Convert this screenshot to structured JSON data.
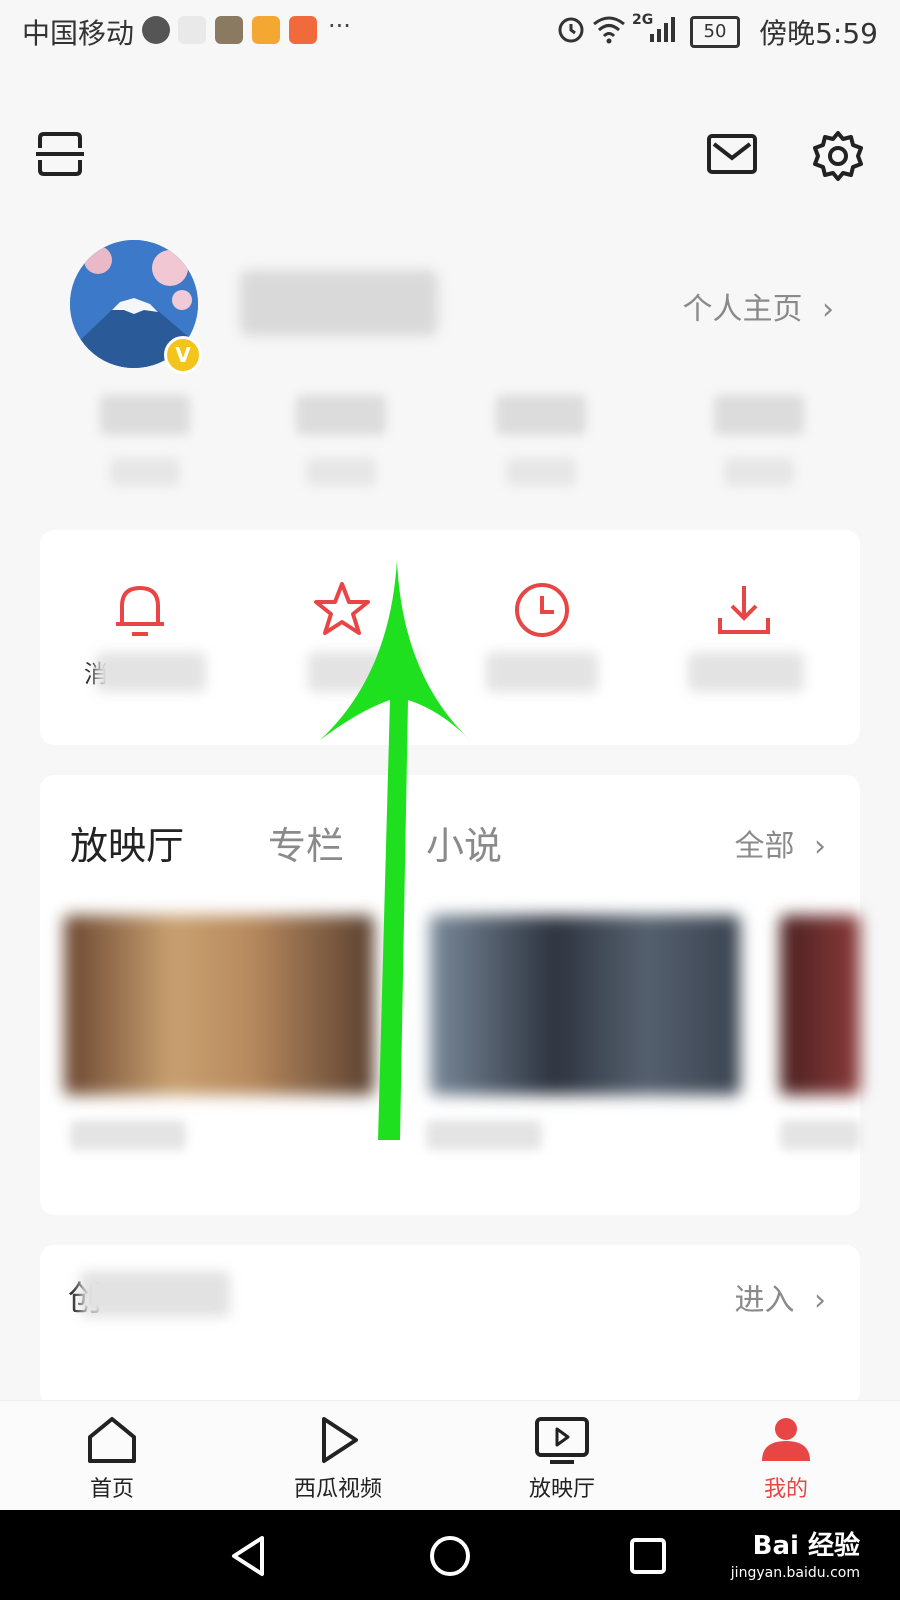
{
  "status_bar": {
    "carrier": "中国移动",
    "more": "···",
    "network": "2G",
    "battery": "50",
    "time": "傍晚5:59"
  },
  "profile": {
    "badge": "V",
    "home_link": "个人主页"
  },
  "quick_actions": {
    "first_label_start": "消"
  },
  "theatre": {
    "tabs": [
      "放映厅",
      "专栏",
      "小说"
    ],
    "all_link": "全部"
  },
  "creator": {
    "title_start": "创",
    "enter_link": "进入"
  },
  "bottom_nav": {
    "items": [
      {
        "label": "首页",
        "active": false
      },
      {
        "label": "西瓜视频",
        "active": false
      },
      {
        "label": "放映厅",
        "active": false
      },
      {
        "label": "我的",
        "active": true
      }
    ]
  },
  "watermark": {
    "text": "Bai 经验",
    "sub": "jingyan.baidu.com"
  },
  "colors": {
    "accent": "#e84545",
    "annotation_arrow": "#1ee01e",
    "badge": "#f3c419"
  }
}
